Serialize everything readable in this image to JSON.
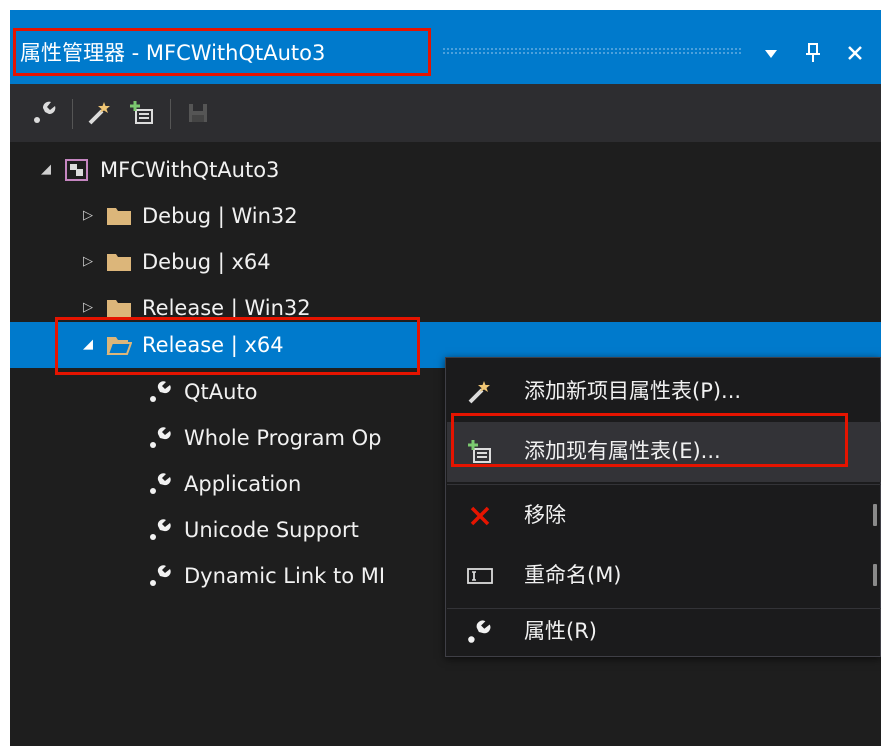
{
  "window": {
    "title": "属性管理器 - MFCWithQtAuto3",
    "buttons": {
      "dropdown": "▾",
      "pin": "ᵖ",
      "close": "✕"
    }
  },
  "toolbar": {
    "icons": [
      "wrench-icon",
      "magic-wand-icon",
      "add-existing-sheet-icon",
      "save-icon"
    ]
  },
  "tree": {
    "project": "MFCWithQtAuto3",
    "configs": [
      {
        "label": "Debug | Win32",
        "expanded": false
      },
      {
        "label": "Debug | x64",
        "expanded": false
      },
      {
        "label": "Release | Win32",
        "expanded": false
      },
      {
        "label": "Release | x64",
        "expanded": true,
        "selected": true
      }
    ],
    "sheets": [
      {
        "label": "QtAuto"
      },
      {
        "label": "Whole Program Op"
      },
      {
        "label": "Application"
      },
      {
        "label": "Unicode Support"
      },
      {
        "label": "Dynamic Link to MI"
      }
    ]
  },
  "context_menu": {
    "items": [
      {
        "label": "添加新项目属性表(P)...",
        "icon": "magic-wand-icon"
      },
      {
        "label": "添加现有属性表(E)...",
        "icon": "add-existing-sheet-icon",
        "highlighted": true
      },
      {
        "label": "移除",
        "icon": "remove-x-icon"
      },
      {
        "label": "重命名(M)",
        "icon": "rename-icon"
      },
      {
        "label": "属性(R)",
        "icon": "wrench-icon"
      }
    ]
  },
  "colors": {
    "accent": "#007acc",
    "background": "#1e1e1e",
    "toolbar": "#2d2d30",
    "folder": "#dcb67a",
    "annotation": "#e51400",
    "remove": "#e51400"
  }
}
